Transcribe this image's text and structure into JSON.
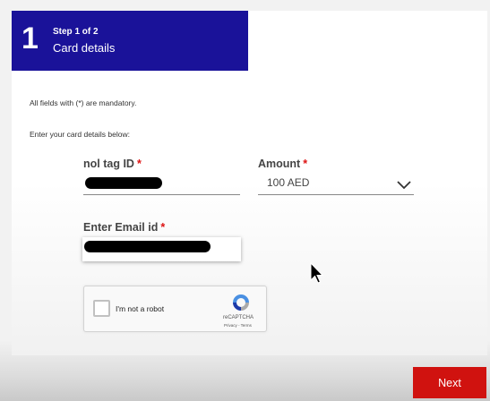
{
  "step": {
    "number": "1",
    "of": "Step 1 of 2",
    "title": "Card details"
  },
  "notes": {
    "mandatory": "All fields with (*) are mandatory.",
    "instructions": "Enter your card details below:"
  },
  "fields": {
    "nol_tag": {
      "label": "nol tag ID",
      "required_mark": "*",
      "value_redacted": true
    },
    "amount": {
      "label": "Amount",
      "required_mark": "*",
      "value": "100 AED"
    },
    "email": {
      "label": "Enter Email id",
      "required_mark": "*",
      "value_redacted": true
    }
  },
  "captcha": {
    "label": "I'm not a robot",
    "brand": "reCAPTCHA",
    "links": "Privacy - Terms",
    "checked": false
  },
  "actions": {
    "next_label": "Next"
  },
  "colors": {
    "header_bg": "#1a1299",
    "next_bg": "#d0120f",
    "required": "#dd1111"
  },
  "icons": {
    "amount_dropdown": "chevron-down-icon",
    "captcha_logo": "recaptcha-icon",
    "cursor": "mouse-pointer-icon"
  }
}
